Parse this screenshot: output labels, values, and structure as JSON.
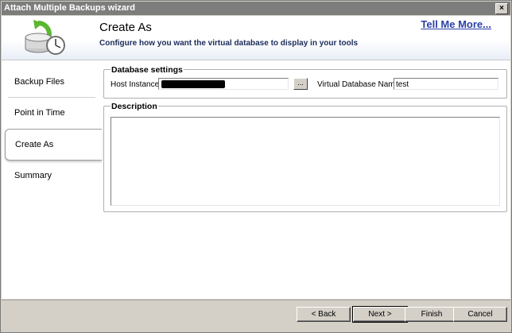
{
  "window": {
    "title": "Attach Multiple Backups wizard",
    "close_glyph": "×"
  },
  "header": {
    "title": "Create As",
    "subtitle": "Configure how you want the virtual database to display in your tools",
    "help_link": "Tell Me More..."
  },
  "sidebar": {
    "items": [
      {
        "label": "Backup Files",
        "active": false
      },
      {
        "label": "Point in Time",
        "active": false
      },
      {
        "label": "Create As",
        "active": true
      },
      {
        "label": "Summary",
        "active": false
      }
    ]
  },
  "database_settings": {
    "legend": "Database settings",
    "host_instance_label": "Host Instance",
    "host_instance_value": "",
    "host_instance_redacted": true,
    "browse_label": "...",
    "virtual_db_name_label": "Virtual Database Name",
    "virtual_db_name_value": "test"
  },
  "description": {
    "legend": "Description",
    "value": ""
  },
  "footer": {
    "back_label": "< Back",
    "next_label": "Next >",
    "finish_label": "Finish",
    "cancel_label": "Cancel"
  },
  "colors": {
    "link": "#2a40a8",
    "subtitle": "#1a2c5a",
    "titlebar": "#7d7d7d"
  },
  "icons": {
    "header": "database-backup-clock-icon"
  }
}
